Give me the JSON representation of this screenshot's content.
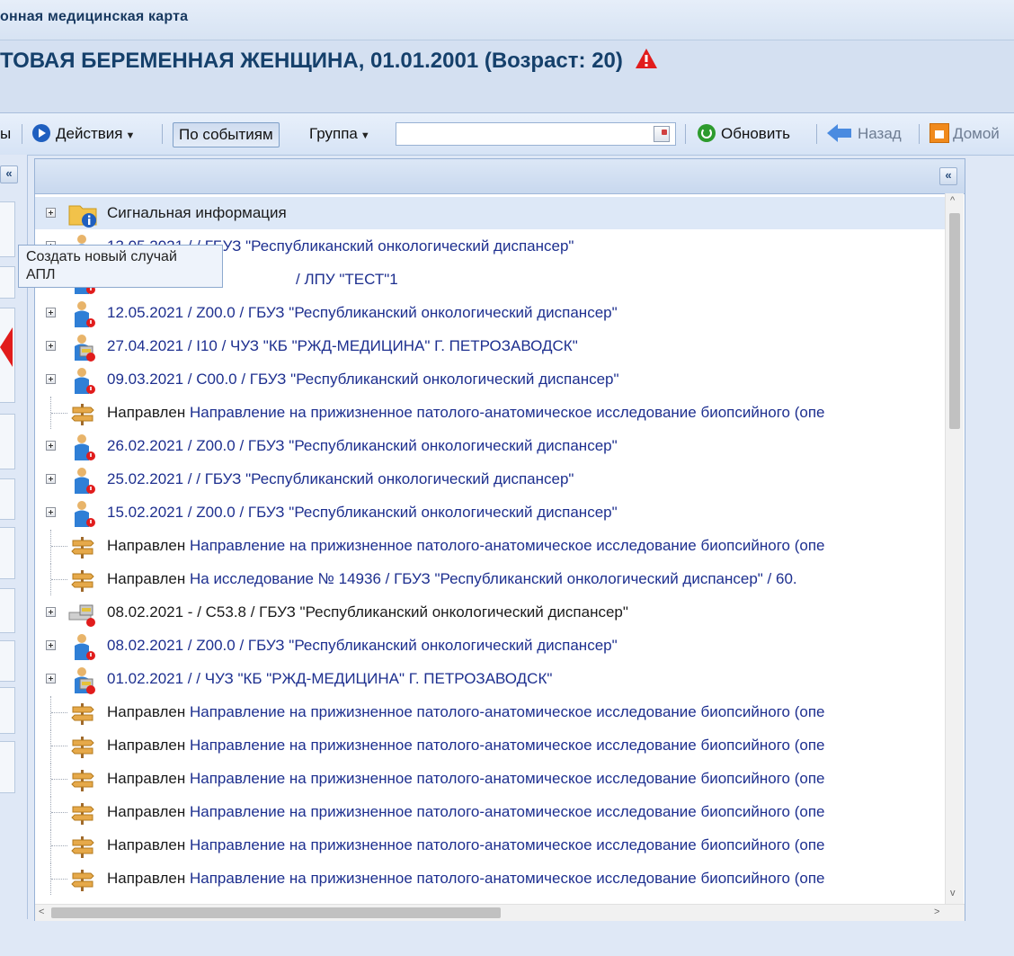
{
  "window": {
    "title": "онная медицинская карта"
  },
  "patient": {
    "header": "ТОВАЯ БЕРЕМЕННАЯ ЖЕНЩИНА, 01.01.2001 (Возраст: 20)"
  },
  "toolbar": {
    "cut_label": "ы",
    "actions_label": "Действия",
    "by_events_label": "По событиям",
    "group_label": "Группа",
    "search_value": "",
    "refresh_label": "Обновить",
    "back_label": "Назад",
    "home_label": "Домой"
  },
  "tooltip": {
    "line1": "Создать новый случай",
    "line2": "АПЛ"
  },
  "collapse_glyph": "«",
  "tree": {
    "rows": [
      {
        "icon": "folder-info-icon",
        "expandable": true,
        "text": "Сигнальная информация",
        "style": "dark",
        "selected": true
      },
      {
        "icon": "person-alert-icon",
        "expandable": true,
        "text": "13.05.2021  /  / ГБУЗ \"Республиканский онкологический диспансер\"",
        "style": "blue"
      },
      {
        "icon": "person-alert-icon",
        "expandable": true,
        "text": "/ ЛПУ \"ТЕСТ\"1",
        "style": "blue",
        "offset": true
      },
      {
        "icon": "person-alert-icon",
        "expandable": true,
        "text": "12.05.2021  /  Z00.0  /  ГБУЗ \"Республиканский онкологический диспансер\"",
        "style": "blue"
      },
      {
        "icon": "person-locked-icon",
        "expandable": true,
        "text": "27.04.2021  /  I10  /  ЧУЗ \"КБ \"РЖД-МЕДИЦИНА\" Г. ПЕТРОЗАВОДСК\"",
        "style": "blue"
      },
      {
        "icon": "person-alert-icon",
        "expandable": true,
        "text": "09.03.2021  /  C00.0  /  ГБУЗ \"Республиканский онкологический диспансер\"",
        "style": "blue"
      },
      {
        "icon": "signpost-icon",
        "expandable": false,
        "prefix": "Направлен",
        "text": "Направление на прижизненное патолого-анатомическое исследование биопсийного (опе",
        "style": "blue"
      },
      {
        "icon": "person-alert-icon",
        "expandable": true,
        "text": "26.02.2021  /  Z00.0  /  ГБУЗ \"Республиканский онкологический диспансер\"",
        "style": "blue"
      },
      {
        "icon": "person-alert-icon",
        "expandable": true,
        "text": "25.02.2021  /  /  ГБУЗ \"Республиканский онкологический диспансер\"",
        "style": "blue"
      },
      {
        "icon": "person-alert-icon",
        "expandable": true,
        "text": "15.02.2021  /  Z00.0  /  ГБУЗ \"Республиканский онкологический диспансер\"",
        "style": "blue"
      },
      {
        "icon": "signpost-icon",
        "expandable": false,
        "prefix": "Направлен",
        "text": "Направление на прижизненное патолого-анатомическое исследование биопсийного (опе",
        "style": "blue"
      },
      {
        "icon": "signpost-icon",
        "expandable": false,
        "prefix": "Направлен",
        "text": "На исследование  №  14936  /  ГБУЗ \"Республиканский онкологический диспансер\"  /  60.",
        "style": "blue"
      },
      {
        "icon": "bed-locked-icon",
        "expandable": true,
        "text": "08.02.2021 - / C53.8 / ГБУЗ \"Республиканский онкологический диспансер\"",
        "style": "dark"
      },
      {
        "icon": "person-alert-icon",
        "expandable": true,
        "text": "08.02.2021  /  Z00.0  /  ГБУЗ \"Республиканский онкологический диспансер\"",
        "style": "blue"
      },
      {
        "icon": "person-locked-icon",
        "expandable": true,
        "text": "01.02.2021  /  /  ЧУЗ \"КБ \"РЖД-МЕДИЦИНА\" Г. ПЕТРОЗАВОДСК\"",
        "style": "blue"
      },
      {
        "icon": "signpost-icon",
        "expandable": false,
        "prefix": "Направлен",
        "text": "Направление на прижизненное патолого-анатомическое исследование биопсийного (опе",
        "style": "blue"
      },
      {
        "icon": "signpost-icon",
        "expandable": false,
        "prefix": "Направлен",
        "text": "Направление на прижизненное патолого-анатомическое исследование биопсийного (опе",
        "style": "blue"
      },
      {
        "icon": "signpost-icon",
        "expandable": false,
        "prefix": "Направлен",
        "text": "Направление на прижизненное патолого-анатомическое исследование биопсийного (опе",
        "style": "blue"
      },
      {
        "icon": "signpost-icon",
        "expandable": false,
        "prefix": "Направлен",
        "text": "Направление на прижизненное патолого-анатомическое исследование биопсийного (опе",
        "style": "blue"
      },
      {
        "icon": "signpost-icon",
        "expandable": false,
        "prefix": "Направлен",
        "text": "Направление на прижизненное патолого-анатомическое исследование биопсийного (опе",
        "style": "blue"
      },
      {
        "icon": "signpost-icon",
        "expandable": false,
        "prefix": "Направлен",
        "text": "Направление на прижизненное патолого-анатомическое исследование биопсийного (опе",
        "style": "blue"
      }
    ]
  },
  "colors": {
    "accent_blue": "#1d2f8f",
    "warning_red": "#e11c1c",
    "panel_bg": "#dfe8f6",
    "selected_row": "#dde8f7"
  }
}
